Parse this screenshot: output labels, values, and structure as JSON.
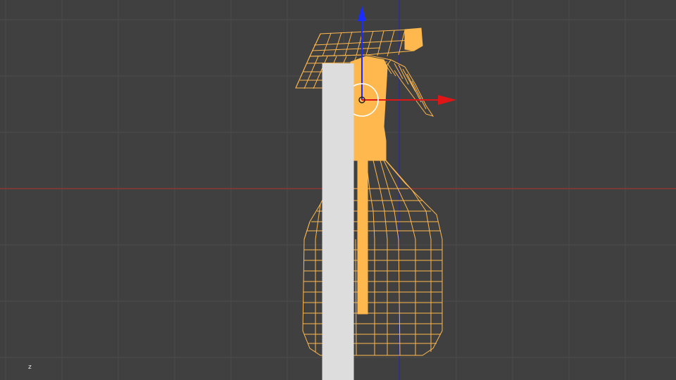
{
  "viewport": {
    "background": "#404040",
    "grid_color": "#4a4a4a",
    "axis_x_color": "#a23a3a",
    "axis_z_color": "#2d2db8"
  },
  "object": {
    "name_icon": "spray-bottle-wireframe",
    "wire_color": "#ffb84d",
    "solid_color": "#ffb84d"
  },
  "gizmo": {
    "x_arrow_color": "#e01515",
    "z_arrow_color": "#1a2cff",
    "pivot_ring_color": "#ffffff"
  },
  "mini_axis": {
    "label": "z"
  }
}
